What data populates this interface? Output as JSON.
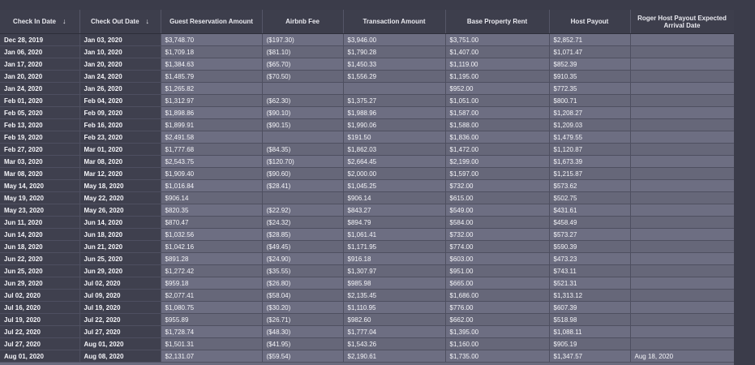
{
  "columns": [
    {
      "label": "Check In Date",
      "sort": true
    },
    {
      "label": "Check Out Date",
      "sort": true
    },
    {
      "label": "Guest Reservation Amount",
      "sort": false
    },
    {
      "label": "Airbnb Fee",
      "sort": false
    },
    {
      "label": "Transaction Amount",
      "sort": false
    },
    {
      "label": "Base Property Rent",
      "sort": false
    },
    {
      "label": "Host Payout",
      "sort": false
    },
    {
      "label": "Roger Host Payout Expected Arrival Date",
      "sort": false
    }
  ],
  "sort_icon": "arrow-down-icon",
  "rows": [
    [
      "Dec 28, 2019",
      "Jan 03, 2020",
      "$3,748.70",
      "($197.30)",
      "$3,946.00",
      "$3,751.00",
      "$2,852.71",
      ""
    ],
    [
      "Jan 06, 2020",
      "Jan 10, 2020",
      "$1,709.18",
      "($81.10)",
      "$1,790.28",
      "$1,407.00",
      "$1,071.47",
      ""
    ],
    [
      "Jan 17, 2020",
      "Jan 20, 2020",
      "$1,384.63",
      "($65.70)",
      "$1,450.33",
      "$1,119.00",
      "$852.39",
      ""
    ],
    [
      "Jan 20, 2020",
      "Jan 24, 2020",
      "$1,485.79",
      "($70.50)",
      "$1,556.29",
      "$1,195.00",
      "$910.35",
      ""
    ],
    [
      "Jan 24, 2020",
      "Jan 26, 2020",
      "$1,265.82",
      "",
      "",
      "$952.00",
      "$772.35",
      ""
    ],
    [
      "Feb 01, 2020",
      "Feb 04, 2020",
      "$1,312.97",
      "($62.30)",
      "$1,375.27",
      "$1,051.00",
      "$800.71",
      ""
    ],
    [
      "Feb 05, 2020",
      "Feb 09, 2020",
      "$1,898.86",
      "($90.10)",
      "$1,988.96",
      "$1,587.00",
      "$1,208.27",
      ""
    ],
    [
      "Feb 13, 2020",
      "Feb 16, 2020",
      "$1,899.91",
      "($90.15)",
      "$1,990.06",
      "$1,588.00",
      "$1,209.03",
      ""
    ],
    [
      "Feb 19, 2020",
      "Feb 23, 2020",
      "$2,491.58",
      "",
      "$191.50",
      "$1,836.00",
      "$1,479.55",
      ""
    ],
    [
      "Feb 27, 2020",
      "Mar 01, 2020",
      "$1,777.68",
      "($84.35)",
      "$1,862.03",
      "$1,472.00",
      "$1,120.87",
      ""
    ],
    [
      "Mar 03, 2020",
      "Mar 08, 2020",
      "$2,543.75",
      "($120.70)",
      "$2,664.45",
      "$2,199.00",
      "$1,673.39",
      ""
    ],
    [
      "Mar 08, 2020",
      "Mar 12, 2020",
      "$1,909.40",
      "($90.60)",
      "$2,000.00",
      "$1,597.00",
      "$1,215.87",
      ""
    ],
    [
      "May 14, 2020",
      "May 18, 2020",
      "$1,016.84",
      "($28.41)",
      "$1,045.25",
      "$732.00",
      "$573.62",
      ""
    ],
    [
      "May 19, 2020",
      "May 22, 2020",
      "$906.14",
      "",
      "$906.14",
      "$615.00",
      "$502.75",
      ""
    ],
    [
      "May 23, 2020",
      "May 26, 2020",
      "$820.35",
      "($22.92)",
      "$843.27",
      "$549.00",
      "$431.61",
      ""
    ],
    [
      "Jun 11, 2020",
      "Jun 14, 2020",
      "$870.47",
      "($24.32)",
      "$894.79",
      "$584.00",
      "$458.49",
      ""
    ],
    [
      "Jun 14, 2020",
      "Jun 18, 2020",
      "$1,032.56",
      "($28.85)",
      "$1,061.41",
      "$732.00",
      "$573.27",
      ""
    ],
    [
      "Jun 18, 2020",
      "Jun 21, 2020",
      "$1,042.16",
      "($49.45)",
      "$1,171.95",
      "$774.00",
      "$590.39",
      ""
    ],
    [
      "Jun 22, 2020",
      "Jun 25, 2020",
      "$891.28",
      "($24.90)",
      "$916.18",
      "$603.00",
      "$473.23",
      ""
    ],
    [
      "Jun 25, 2020",
      "Jun 29, 2020",
      "$1,272.42",
      "($35.55)",
      "$1,307.97",
      "$951.00",
      "$743.11",
      ""
    ],
    [
      "Jun 29, 2020",
      "Jul 02, 2020",
      "$959.18",
      "($26.80)",
      "$985.98",
      "$665.00",
      "$521.31",
      ""
    ],
    [
      "Jul 02, 2020",
      "Jul 09, 2020",
      "$2,077.41",
      "($58.04)",
      "$2,135.45",
      "$1,686.00",
      "$1,313.12",
      ""
    ],
    [
      "Jul 16, 2020",
      "Jul 19, 2020",
      "$1,080.75",
      "($30.20)",
      "$1,110.95",
      "$776.00",
      "$607.39",
      ""
    ],
    [
      "Jul 19, 2020",
      "Jul 22, 2020",
      "$955.89",
      "($26.71)",
      "$982.60",
      "$662.00",
      "$518.98",
      ""
    ],
    [
      "Jul 22, 2020",
      "Jul 27, 2020",
      "$1,728.74",
      "($48.30)",
      "$1,777.04",
      "$1,395.00",
      "$1,088.11",
      ""
    ],
    [
      "Jul 27, 2020",
      "Aug 01, 2020",
      "$1,501.31",
      "($41.95)",
      "$1,543.26",
      "$1,160.00",
      "$905.19",
      ""
    ],
    [
      "Aug 01, 2020",
      "Aug 08, 2020",
      "$2,131.07",
      "($59.54)",
      "$2,190.61",
      "$1,735.00",
      "$1,347.57",
      "Aug 18, 2020"
    ]
  ]
}
